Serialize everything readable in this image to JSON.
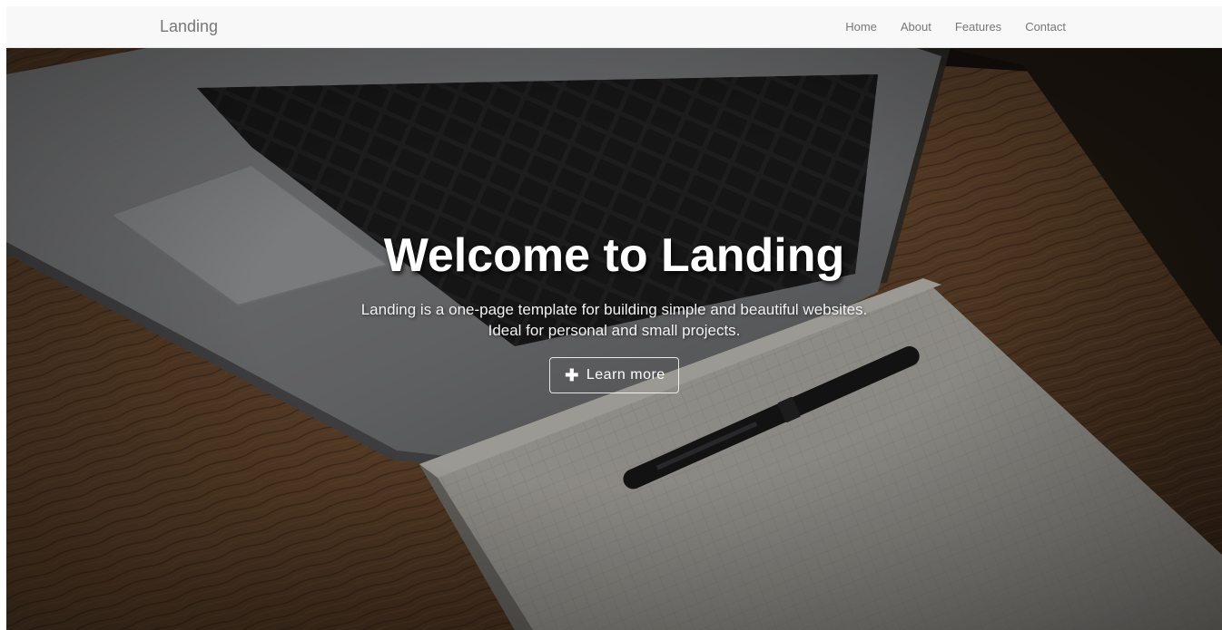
{
  "navbar": {
    "brand": "Landing",
    "links": [
      {
        "label": "Home"
      },
      {
        "label": "About"
      },
      {
        "label": "Features"
      },
      {
        "label": "Contact"
      }
    ]
  },
  "hero": {
    "title": "Welcome to Landing",
    "subtitle_line1": "Landing is a one-page template for building simple and beautiful websites.",
    "subtitle_line2": "Ideal for personal and small projects.",
    "button": {
      "icon": "plus-icon",
      "label": "Learn more"
    },
    "background_image": "laptop-notebook-pen-photo"
  },
  "colors": {
    "navbar_bg": "#f8f8f8",
    "nav_text": "#777777",
    "hero_text": "#ffffff"
  }
}
